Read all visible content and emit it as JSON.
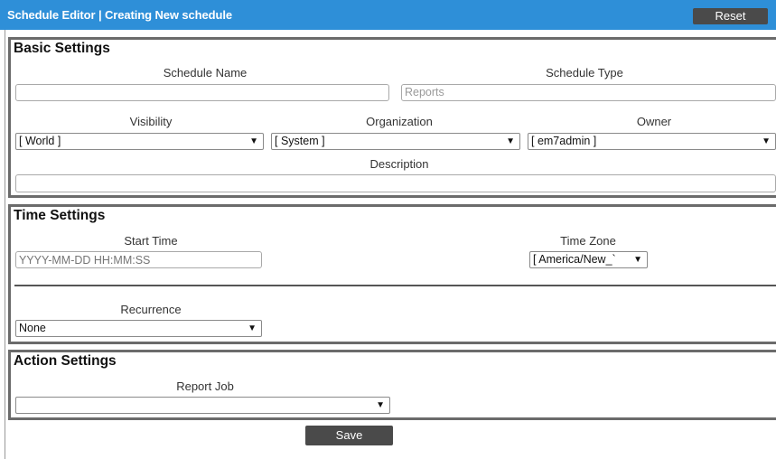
{
  "header": {
    "title": "Schedule Editor | Creating New schedule",
    "reset_label": "Reset"
  },
  "basic_settings": {
    "title": "Basic Settings",
    "schedule_name": {
      "label": "Schedule Name",
      "value": ""
    },
    "schedule_type": {
      "label": "Schedule Type",
      "value": "Reports"
    },
    "visibility": {
      "label": "Visibility",
      "selected": "[ World ]"
    },
    "organization": {
      "label": "Organization",
      "selected": "[ System ]"
    },
    "owner": {
      "label": "Owner",
      "selected": "[ em7admin ]"
    },
    "description": {
      "label": "Description",
      "value": ""
    }
  },
  "time_settings": {
    "title": "Time Settings",
    "start_time": {
      "label": "Start Time",
      "placeholder": "YYYY-MM-DD HH:MM:SS"
    },
    "time_zone": {
      "label": "Time Zone",
      "selected": "[ America/New_`"
    },
    "recurrence": {
      "label": "Recurrence",
      "selected": "None"
    }
  },
  "action_settings": {
    "title": "Action Settings",
    "report_job": {
      "label": "Report Job",
      "selected": ""
    }
  },
  "footer": {
    "save_label": "Save"
  },
  "icons": {
    "dropdown": "▼"
  },
  "colors": {
    "header_bg": "#2e8fd8",
    "button_bg": "#4a4a4a",
    "section_border": "#6b6b6b"
  }
}
